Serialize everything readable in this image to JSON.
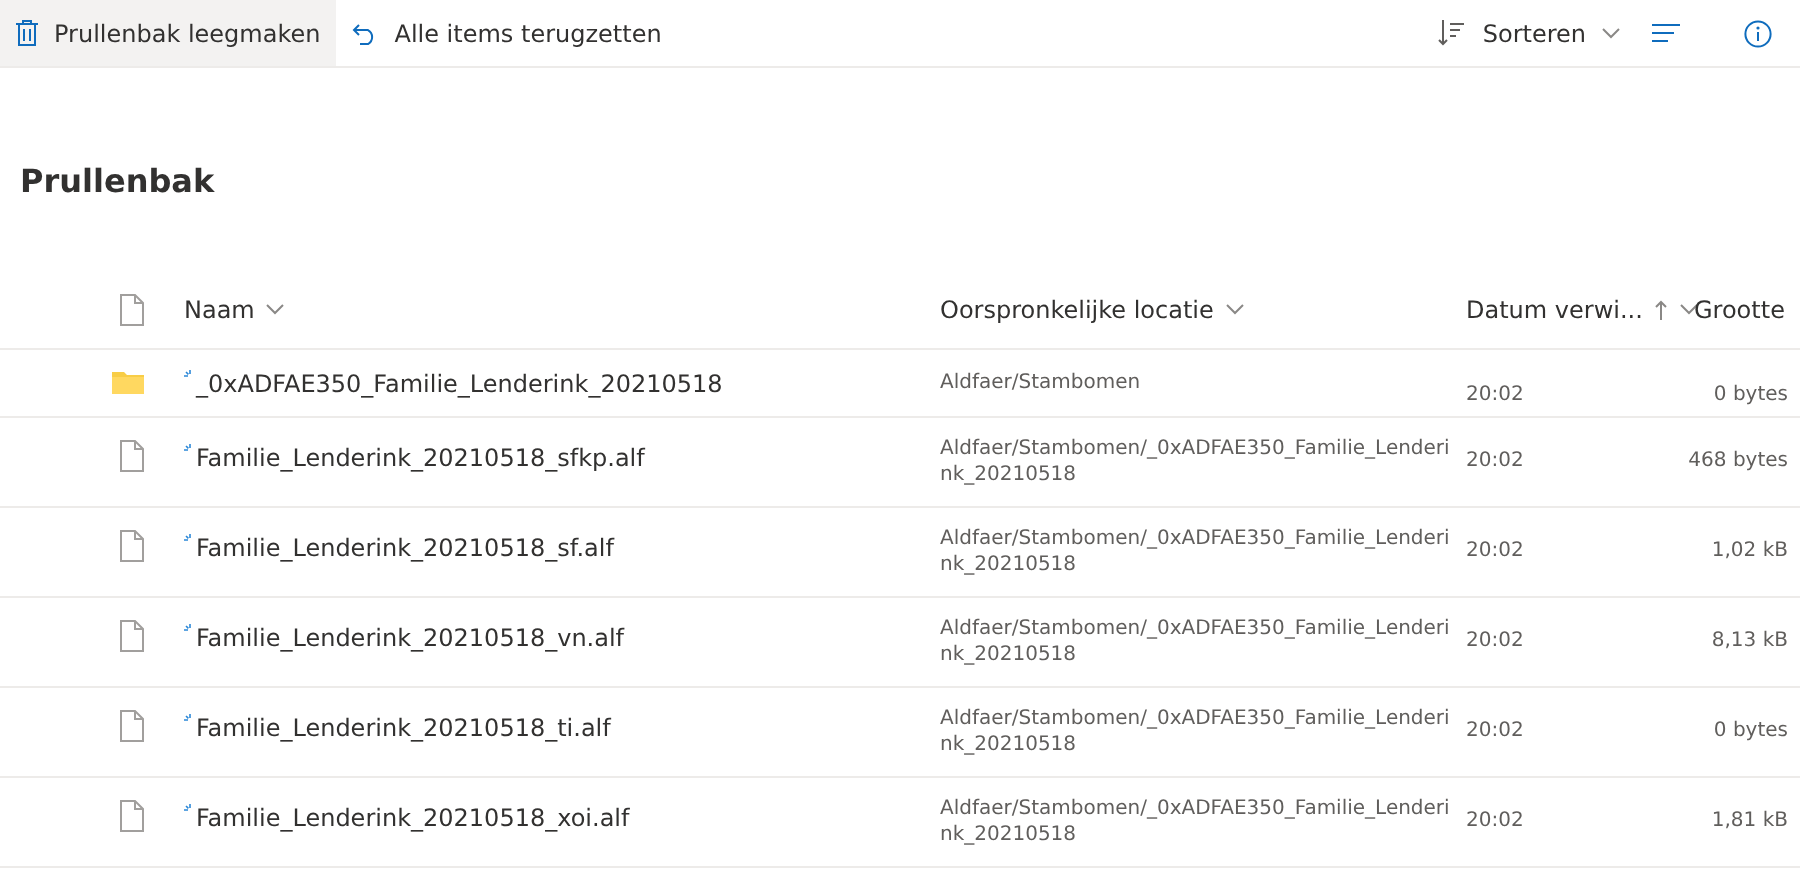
{
  "toolbar": {
    "left": [
      {
        "kind": "trash",
        "label": "Prullenbak leegmaken",
        "selected": true
      },
      {
        "kind": "restore",
        "label": "Alle items terugzetten",
        "selected": false
      }
    ],
    "sort": {
      "label": "Sorteren"
    }
  },
  "title": "Prullenbak",
  "table": {
    "columns": [
      {
        "label": "Naam",
        "sorted": false
      },
      {
        "label": "Oorspronkelijke locatie",
        "sorted": false
      },
      {
        "label": "Datum verwi...",
        "sorted": true
      },
      {
        "label": "Grootte",
        "sorted": false
      }
    ],
    "rows": [
      {
        "kind": "folder",
        "name": "_0xADFAE350_Familie_Lenderink_20210518",
        "location": "Aldfaer/Stambomen",
        "date": "20:02",
        "size": "0 bytes"
      },
      {
        "kind": "file",
        "name": "Familie_Lenderink_20210518_sfkp.alf",
        "location": "Aldfaer/Stambomen/_0xADFAE350_Familie_Lenderink_20210518",
        "date": "20:02",
        "size": "468 bytes"
      },
      {
        "kind": "file",
        "name": "Familie_Lenderink_20210518_sf.alf",
        "location": "Aldfaer/Stambomen/_0xADFAE350_Familie_Lenderink_20210518",
        "date": "20:02",
        "size": "1,02 kB"
      },
      {
        "kind": "file",
        "name": "Familie_Lenderink_20210518_vn.alf",
        "location": "Aldfaer/Stambomen/_0xADFAE350_Familie_Lenderink_20210518",
        "date": "20:02",
        "size": "8,13 kB"
      },
      {
        "kind": "file",
        "name": "Familie_Lenderink_20210518_ti.alf",
        "location": "Aldfaer/Stambomen/_0xADFAE350_Familie_Lenderink_20210518",
        "date": "20:02",
        "size": "0 bytes"
      },
      {
        "kind": "file",
        "name": "Familie_Lenderink_20210518_xoi.alf",
        "location": "Aldfaer/Stambomen/_0xADFAE350_Familie_Lenderink_20210518",
        "date": "20:02",
        "size": "1,81 kB"
      }
    ]
  }
}
